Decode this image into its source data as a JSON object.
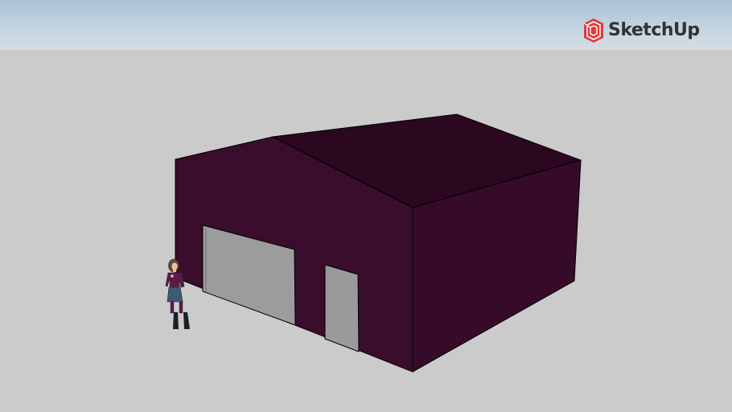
{
  "app": {
    "brand_name": "SketchUp",
    "brand_color": "#e03a3e"
  },
  "scene": {
    "sky_color": "#b9cddc",
    "ground_color": "#cbcbcb",
    "building": {
      "wall_color": "#390d2b",
      "roof_color": "#2e0822",
      "door_color": "#9b9b9b"
    },
    "scale_figure": {
      "top_color": "#5a1a4a",
      "skirt_color": "#3c5a78",
      "boot_color": "#1e1e1e"
    }
  }
}
